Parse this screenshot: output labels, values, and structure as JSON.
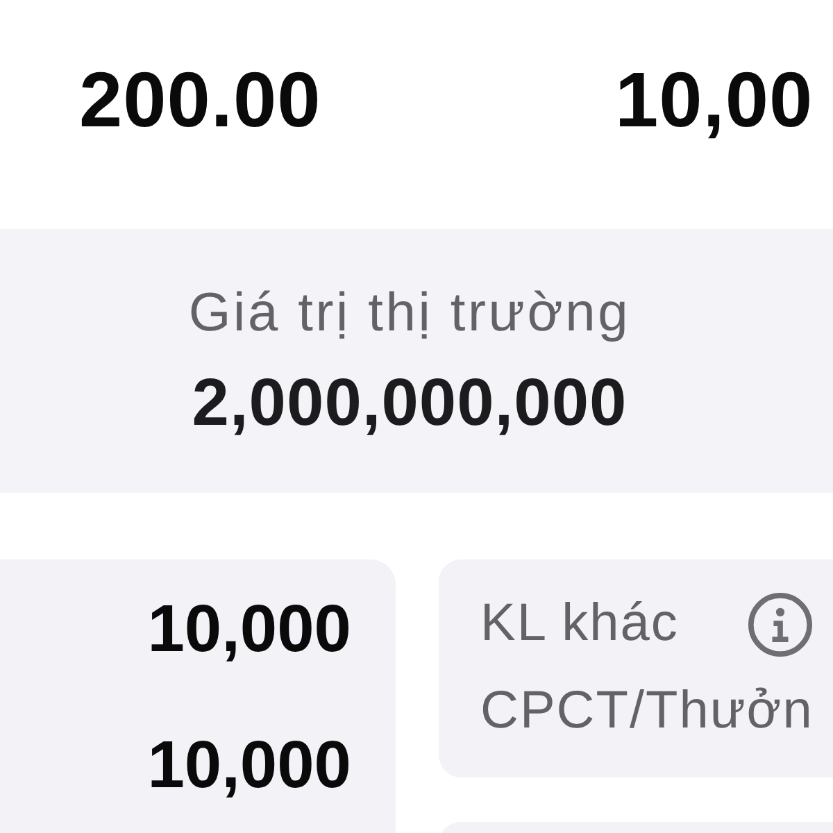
{
  "summary": {
    "values": [
      "200.00",
      "10,00"
    ]
  },
  "market_value": {
    "label": "Giá trị thị trường",
    "value": "2,000,000,000"
  },
  "volume_card": {
    "values": [
      "10,000",
      "10,000"
    ]
  },
  "other_volume_card": {
    "title": "KL khác",
    "subtitle": "CPCT/Thưởn"
  }
}
